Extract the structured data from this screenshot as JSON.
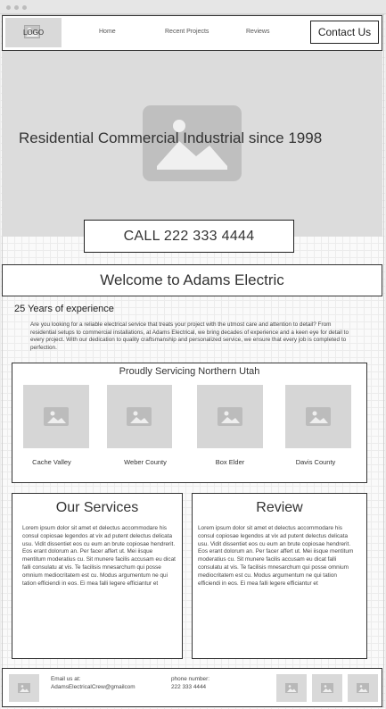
{
  "header": {
    "logo": "LOGO",
    "nav": [
      "Home",
      "Recent Projects",
      "Reviews"
    ],
    "contact_label": "Contact Us"
  },
  "hero": {
    "headline": "Residential Commercial Industrial since 1998",
    "call_label": "CALL 222 333 4444"
  },
  "welcome": {
    "title": "Welcome to Adams Electric"
  },
  "experience": {
    "title": "25 Years of experience",
    "body": "Are you looking for a reliable electrical service that treats your project with the utmost care and attention to detail? From residential setups to commercial installations, at Adams Electrical, we bring decades of experience and a keen eye for detail to every project. With our dedication to quality craftsmanship and personalized service, we ensure that every job is completed to perfection."
  },
  "service_area": {
    "title": "Proudly Servicing Northern Utah",
    "counties": [
      "Cache Valley",
      "Weber County",
      "Box Elder",
      "Davis County"
    ]
  },
  "services": {
    "title": "Our Services",
    "body": "Lorem ipsum dolor sit amet et delectus accommodare his consul copiosae legendos at vix ad putent delectus delicata usu. Vidit dissentiet eos cu eum an brute copiosae hendrerit. Eos erant dolorum an. Per facer affert ut. Mei iisque mentitum moderatius cu. Sit munere facilis accusam eu dicat falli consulatu at vis. Te facilisis mnesarchum qui posse omnium mediocritatem est cu. Modus argumentum ne qui tation efficiendi in eos. Ei mea falli legere efficiantur et"
  },
  "review": {
    "title": "Review",
    "body": "Lorem ipsum dolor sit amet et delectus accommodare his consul copiosae legendos at vix ad putent delectus delicata usu. Vidit dissentiet eos cu eum an brute copiosae hendrerit. Eos erant dolorum an. Per facer affert ut. Mei iisque mentitum moderatius cu. Sit munere facilis accusam eu dicat falli consulatu at vis. Te facilisis mnesarchum qui posse omnium mediocritatem est cu. Modus argumentum ne qui tation efficiendi in eos. Ei mea falli legere efficiantur et"
  },
  "footer": {
    "email_label": "Email us at:",
    "email": "AdamsElectricalCrew@gmailcom",
    "phone_label": "phone number:",
    "phone": "222 333 4444"
  },
  "icons": {
    "image_placeholder": "image-placeholder-icon"
  },
  "colors": {
    "placeholder_gray": "#d9d9d9",
    "hero_gray": "#dcdcdc",
    "border": "#333333"
  }
}
